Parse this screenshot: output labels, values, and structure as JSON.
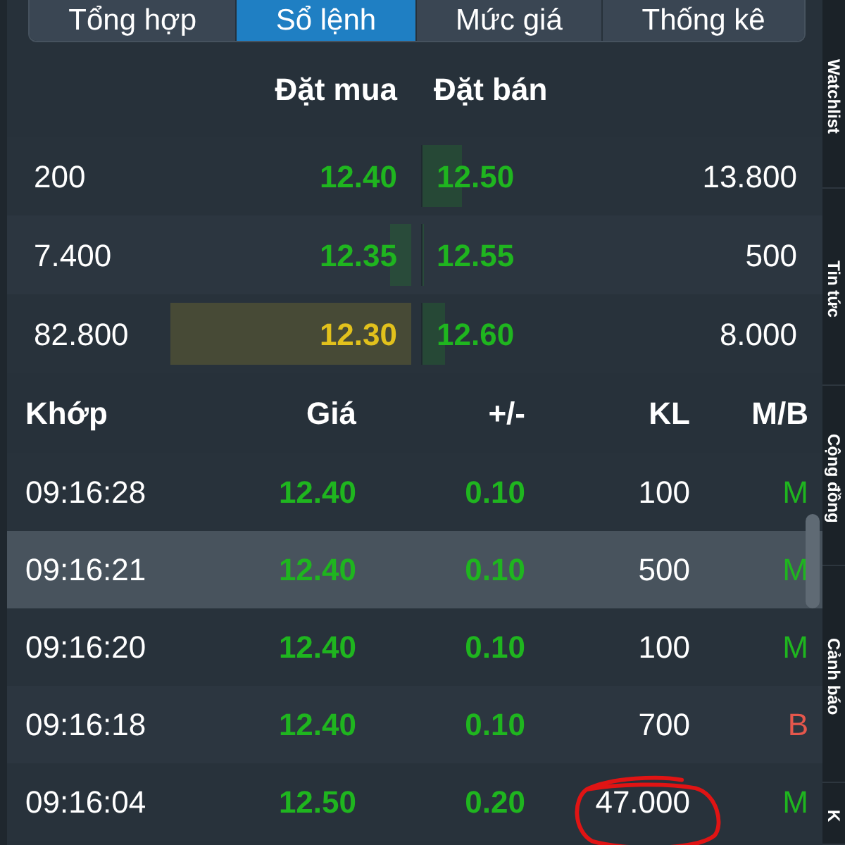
{
  "tabs": [
    {
      "label": "Tổng hợp",
      "selected": false
    },
    {
      "label": "Sổ lệnh",
      "selected": true
    },
    {
      "label": "Mức giá",
      "selected": false
    },
    {
      "label": "Thống kê",
      "selected": false
    }
  ],
  "order_book": {
    "columns": [
      "Đặt mua",
      "Đặt bán"
    ],
    "rows": [
      {
        "bid": {
          "volume": "200",
          "price": "12.40",
          "color": "#1fb51f"
        },
        "ask": {
          "price": "12.50",
          "color": "#1fb51f",
          "volume": "13.800"
        }
      },
      {
        "bid": {
          "volume": "7.400",
          "price": "12.35",
          "color": "#1fb51f"
        },
        "ask": {
          "price": "12.55",
          "color": "#1fb51f",
          "volume": "500"
        }
      },
      {
        "bid": {
          "volume": "82.800",
          "price": "12.30",
          "color": "#e2c11c"
        },
        "ask": {
          "price": "12.60",
          "color": "#1fb51f",
          "volume": "8.000"
        }
      }
    ]
  },
  "trades": {
    "columns": [
      "Khớp",
      "Giá",
      "+/-",
      "KL",
      "M/B"
    ],
    "rows": [
      {
        "time": "09:16:28",
        "price": "12.40",
        "change": "0.10",
        "color": "#1fb51f",
        "volume": "100",
        "side": {
          "label": "M",
          "color": "#1fb51f"
        },
        "selected": false,
        "circled": false
      },
      {
        "time": "09:16:21",
        "price": "12.40",
        "change": "0.10",
        "color": "#1fb51f",
        "volume": "500",
        "side": {
          "label": "M",
          "color": "#1fb51f"
        },
        "selected": true,
        "circled": false
      },
      {
        "time": "09:16:20",
        "price": "12.40",
        "change": "0.10",
        "color": "#1fb51f",
        "volume": "100",
        "side": {
          "label": "M",
          "color": "#1fb51f"
        },
        "selected": false,
        "circled": false
      },
      {
        "time": "09:16:18",
        "price": "12.40",
        "change": "0.10",
        "color": "#1fb51f",
        "volume": "700",
        "side": {
          "label": "B",
          "color": "#e5574c"
        },
        "selected": false,
        "circled": false
      },
      {
        "time": "09:16:04",
        "price": "12.50",
        "change": "0.20",
        "color": "#1fb51f",
        "volume": "47.000",
        "side": {
          "label": "M",
          "color": "#1fb51f"
        },
        "selected": false,
        "circled": true
      }
    ]
  },
  "side_tabs": [
    {
      "label": "Watchlist"
    },
    {
      "label": "Tin tức"
    },
    {
      "label": "Cộng đồng"
    },
    {
      "label": "Cảnh báo"
    },
    {
      "label": "K"
    }
  ]
}
